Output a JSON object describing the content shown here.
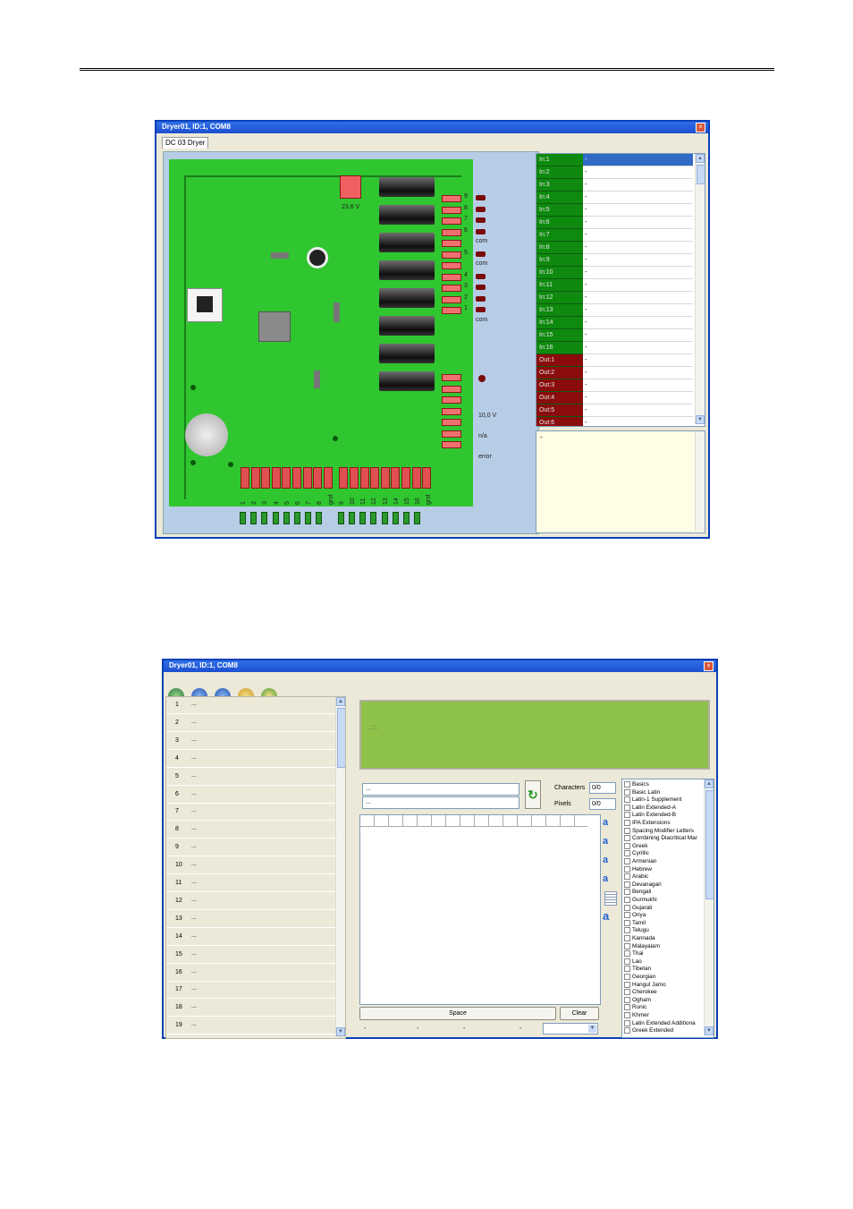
{
  "window1": {
    "title": "Dryer01, ID:1, COM8",
    "close": "×",
    "tab": "DC 03 Dryer",
    "board": {
      "voltage_top": "23,6 V",
      "voltage_bottom": "10,0 V",
      "na_label": "n/a",
      "error_label": "error",
      "right_pin_labels": [
        "9",
        "8",
        "7",
        "6",
        "com",
        "5",
        "com",
        "4",
        "3",
        "2",
        "1",
        "com"
      ],
      "bottom_pin_labels": [
        "1",
        "2",
        "3",
        "4",
        "5",
        "6",
        "7",
        "8",
        "gnd",
        "9",
        "10",
        "11",
        "12",
        "13",
        "14",
        "15",
        "16",
        "gnd"
      ]
    },
    "io_rows": [
      {
        "name": "In:1",
        "value": "-",
        "type": "in"
      },
      {
        "name": "In:2",
        "value": "-",
        "type": "in"
      },
      {
        "name": "In:3",
        "value": "-",
        "type": "in"
      },
      {
        "name": "In:4",
        "value": "-",
        "type": "in"
      },
      {
        "name": "In:5",
        "value": "-",
        "type": "in"
      },
      {
        "name": "In:6",
        "value": "-",
        "type": "in"
      },
      {
        "name": "In:7",
        "value": "-",
        "type": "in"
      },
      {
        "name": "In:8",
        "value": "-",
        "type": "in"
      },
      {
        "name": "In:9",
        "value": "-",
        "type": "in"
      },
      {
        "name": "In:10",
        "value": "-",
        "type": "in"
      },
      {
        "name": "In:11",
        "value": "-",
        "type": "in"
      },
      {
        "name": "In:12",
        "value": "-",
        "type": "in"
      },
      {
        "name": "In:13",
        "value": "-",
        "type": "in"
      },
      {
        "name": "In:14",
        "value": "-",
        "type": "in"
      },
      {
        "name": "In:15",
        "value": "-",
        "type": "in"
      },
      {
        "name": "In:16",
        "value": "-",
        "type": "in"
      },
      {
        "name": "Out:1",
        "value": "-",
        "type": "out"
      },
      {
        "name": "Out:2",
        "value": "-",
        "type": "out"
      },
      {
        "name": "Out:3",
        "value": "-",
        "type": "out"
      },
      {
        "name": "Out:4",
        "value": "-",
        "type": "out"
      },
      {
        "name": "Out:5",
        "value": "-",
        "type": "out"
      },
      {
        "name": "Out:6",
        "value": "-",
        "type": "out"
      }
    ],
    "memo_text": "-",
    "colors": {
      "in_bg": "#0e8a0e",
      "out_bg": "#8a0c0c",
      "pcb": "#2fc62f",
      "canvas": "#b7cde6"
    }
  },
  "window2": {
    "title": "Dryer01, ID:1, COM8",
    "close": "×",
    "toolbar_icons": [
      "connect-icon",
      "save-icon",
      "save-all-icon",
      "open-icon",
      "export-icon"
    ],
    "list_rows": [
      {
        "num": "1",
        "text": "..."
      },
      {
        "num": "2",
        "text": "..."
      },
      {
        "num": "3",
        "text": "..."
      },
      {
        "num": "4",
        "text": "..."
      },
      {
        "num": "5",
        "text": "..."
      },
      {
        "num": "6",
        "text": "..."
      },
      {
        "num": "7",
        "text": "..."
      },
      {
        "num": "8",
        "text": "..."
      },
      {
        "num": "9",
        "text": "..."
      },
      {
        "num": "10",
        "text": "..."
      },
      {
        "num": "11",
        "text": "..."
      },
      {
        "num": "12",
        "text": "..."
      },
      {
        "num": "13",
        "text": "..."
      },
      {
        "num": "14",
        "text": "..."
      },
      {
        "num": "15",
        "text": "..."
      },
      {
        "num": "16",
        "text": "..."
      },
      {
        "num": "17",
        "text": "..."
      },
      {
        "num": "18",
        "text": "..."
      },
      {
        "num": "19",
        "text": "..."
      }
    ],
    "lcd_text": ". : :",
    "input1_value": "...",
    "input2_value": "...",
    "characters_label": "Characters",
    "characters_value": "0/0",
    "pixels_label": "Pixels",
    "pixels_value": "0/0",
    "space_button": "Space",
    "clear_button": "Clear",
    "bottom_dashes": [
      "-",
      "-",
      "-",
      "-"
    ],
    "unicode_blocks": [
      "Basics",
      "Basic Latin",
      "Latin-1 Supplement",
      "Latin Extended-A",
      "Latin Extended-B",
      "IPA Extensions",
      "Spacing Modifier Letters",
      "Combining Diacritical Mar",
      "Greek",
      "Cyrillic",
      "Armenian",
      "Hebrew",
      "Arabic",
      "Devanagari",
      "Bengali",
      "Gurmukhi",
      "Gujarati",
      "Oriya",
      "Tamil",
      "Telugu",
      "Kannada",
      "Malayalam",
      "Thai",
      "Lao",
      "Tibetan",
      "Georgian",
      "Hangul Jamo",
      "Cherokee",
      "Ogham",
      "Runic",
      "Khmer",
      "Latin Extended Additiona",
      "Greek Extended"
    ],
    "colors": {
      "lcd": "#8ec14a"
    }
  }
}
